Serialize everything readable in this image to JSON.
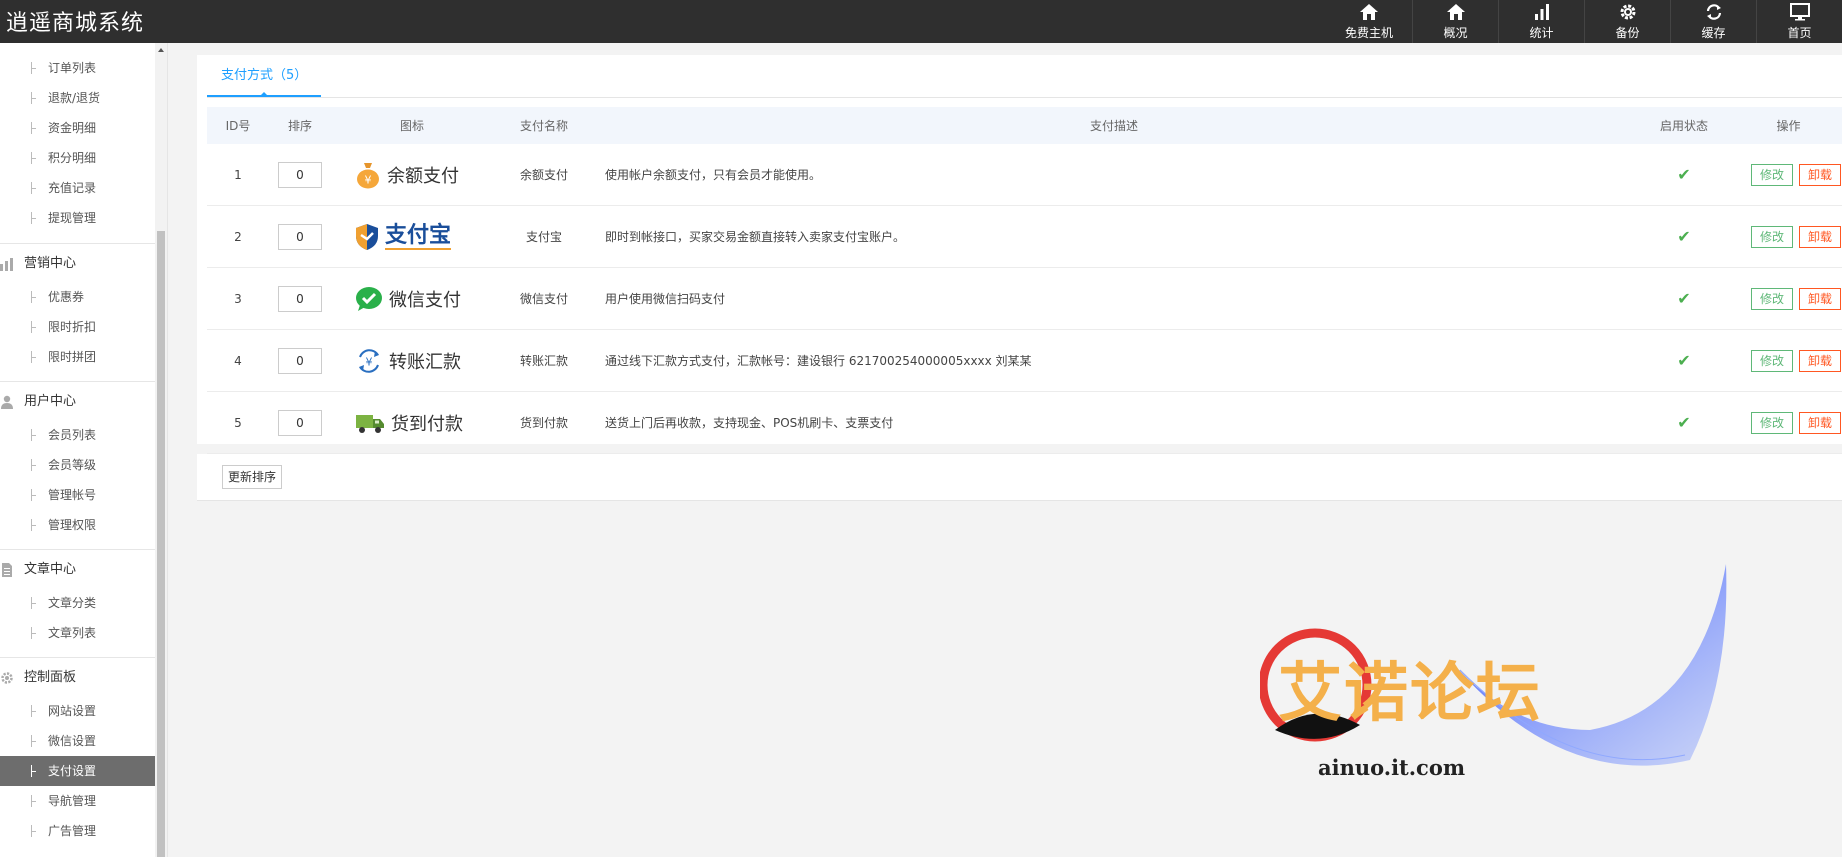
{
  "app": {
    "title": "逍遥商城系统"
  },
  "topnav": [
    {
      "label": "免费主机",
      "icon": "home-icon"
    },
    {
      "label": "概况",
      "icon": "home-icon"
    },
    {
      "label": "统计",
      "icon": "bar-chart-icon"
    },
    {
      "label": "备份",
      "icon": "gear-icon"
    },
    {
      "label": "缓存",
      "icon": "refresh-icon"
    },
    {
      "label": "首页",
      "icon": "monitor-icon"
    }
  ],
  "sidebar": {
    "order_items": [
      "订单列表",
      "退款/退货",
      "资金明细",
      "积分明细",
      "充值记录",
      "提现管理"
    ],
    "marketing": {
      "title": "营销中心",
      "icon": "chart-icon",
      "items": [
        "优惠券",
        "限时折扣",
        "限时拼团"
      ]
    },
    "users": {
      "title": "用户中心",
      "icon": "user-icon",
      "items": [
        "会员列表",
        "会员等级",
        "管理帐号",
        "管理权限"
      ]
    },
    "articles": {
      "title": "文章中心",
      "icon": "document-icon",
      "items": [
        "文章分类",
        "文章列表"
      ]
    },
    "control": {
      "title": "控制面板",
      "icon": "gear-icon",
      "items": [
        "网站设置",
        "微信设置",
        "支付设置",
        "导航管理",
        "广告管理"
      ]
    },
    "active_item": "支付设置"
  },
  "tab": {
    "label": "支付方式（5）"
  },
  "table": {
    "headers": {
      "id": "ID号",
      "sort": "排序",
      "icon": "图标",
      "name": "支付名称",
      "desc": "支付描述",
      "status": "启用状态",
      "action": "操作"
    },
    "rows": [
      {
        "id": "1",
        "sort": "0",
        "logo_text": "余额支付",
        "logo_icon": "money-bag-icon",
        "name": "余额支付",
        "desc": "使用帐户余额支付，只有会员才能使用。",
        "enabled": true
      },
      {
        "id": "2",
        "sort": "0",
        "logo_text": "支付宝",
        "logo_icon": "alipay-shield-icon",
        "name": "支付宝",
        "desc": "即时到帐接口，买家交易金额直接转入卖家支付宝账户。",
        "enabled": true
      },
      {
        "id": "3",
        "sort": "0",
        "logo_text": "微信支付",
        "logo_icon": "wechat-icon",
        "name": "微信支付",
        "desc": "用户使用微信扫码支付",
        "enabled": true
      },
      {
        "id": "4",
        "sort": "0",
        "logo_text": "转账汇款",
        "logo_icon": "transfer-icon",
        "name": "转账汇款",
        "desc": "通过线下汇款方式支付，汇款帐号：建设银行 621700254000005xxxx 刘某某",
        "enabled": true
      },
      {
        "id": "5",
        "sort": "0",
        "logo_text": "货到付款",
        "logo_icon": "truck-icon",
        "name": "货到付款",
        "desc": "送货上门后再收款，支持现金、POS机刷卡、支票支付",
        "enabled": true
      }
    ],
    "edit_label": "修改",
    "uninstall_label": "卸载"
  },
  "footer": {
    "update_sort_label": "更新排序"
  },
  "watermark": {
    "text": "艾诺论坛",
    "url": "ainuo.it.com"
  },
  "colors": {
    "topbar": "#2f2f2f",
    "accent": "#1e9fff",
    "edit": "#5fb878",
    "uninstall": "#ff5722",
    "check": "#4caf50",
    "watermark": "#f4b04a"
  }
}
